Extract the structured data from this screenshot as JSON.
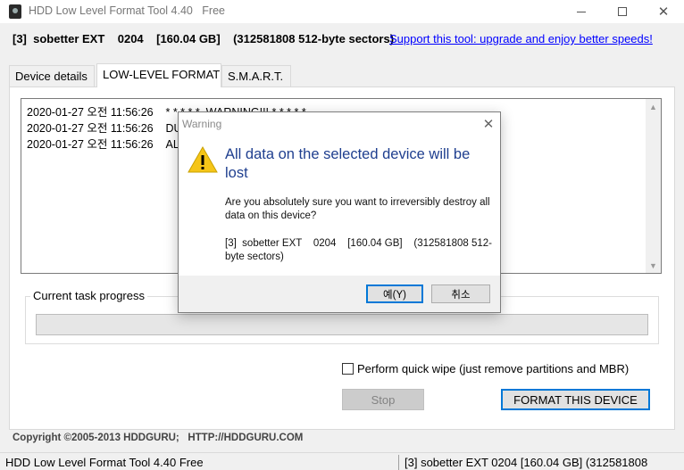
{
  "window": {
    "title": "HDD Low Level Format Tool 4.40   Free",
    "icon": "hdd-icon"
  },
  "device_line": "[3]  sobetter EXT    0204    [160.04 GB]    (312581808 512-byte sectors)",
  "support_link": "Support this tool: upgrade and enjoy better speeds!",
  "tabs": [
    {
      "label": "Device details",
      "active": false
    },
    {
      "label": "LOW-LEVEL FORMAT",
      "active": true
    },
    {
      "label": "S.M.A.R.T.",
      "active": false
    }
  ],
  "log": [
    "2020-01-27 오전 11:56:26    * * * * *  WARNING!!! * * * * *",
    "2020-01-27 오전 11:56:26    DU",
    "2020-01-27 오전 11:56:26    AL"
  ],
  "progress": {
    "title": "Current task progress",
    "value": 0
  },
  "quick_wipe": {
    "label": "Perform quick wipe (just remove partitions and MBR)",
    "checked": false
  },
  "buttons": {
    "stop": "Stop",
    "format": "FORMAT THIS DEVICE"
  },
  "copyright": "Copyright ©2005-2013 HDDGURU;   HTTP://HDDGURU.COM",
  "statusbar": {
    "left": "HDD Low Level Format Tool 4.40    Free",
    "right": "[3]  sobetter EXT    0204    [160.04 GB]    (312581808"
  },
  "dialog": {
    "title": "Warning",
    "heading": "All data on the selected device will be lost",
    "body": "Are you absolutely sure you want to irreversibly destroy all data on this device?",
    "device": "[3]  sobetter EXT    0204    [160.04 GB]    (312581808 512-byte sectors)",
    "yes_label": "예(Y)",
    "cancel_label": "취소"
  },
  "colors": {
    "accent": "#0078d7",
    "link": "#0000ff",
    "dialog_heading": "#1f3f8f",
    "warning_icon": "#f5c518"
  }
}
